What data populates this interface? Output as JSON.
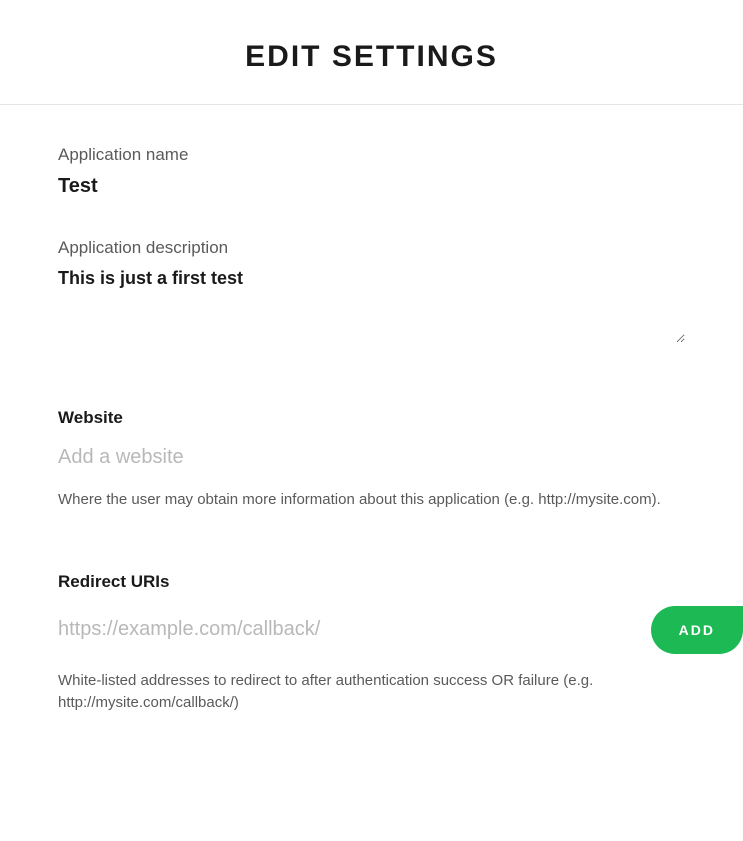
{
  "header": {
    "title": "EDIT SETTINGS"
  },
  "fields": {
    "app_name_label": "Application name",
    "app_name_value": "Test",
    "app_desc_label": "Application description",
    "app_desc_value": "This is just a first test"
  },
  "website": {
    "label": "Website",
    "placeholder": "Add a website",
    "value": "",
    "help": "Where the user may obtain more information about this application (e.g. http://mysite.com)."
  },
  "redirect": {
    "label": "Redirect URIs",
    "placeholder": "https://example.com/callback/",
    "value": "",
    "add_button_label": "ADD",
    "help": "White-listed addresses to redirect to after authentication success OR failure (e.g. http://mysite.com/callback/)"
  },
  "colors": {
    "accent": "#1db954"
  }
}
